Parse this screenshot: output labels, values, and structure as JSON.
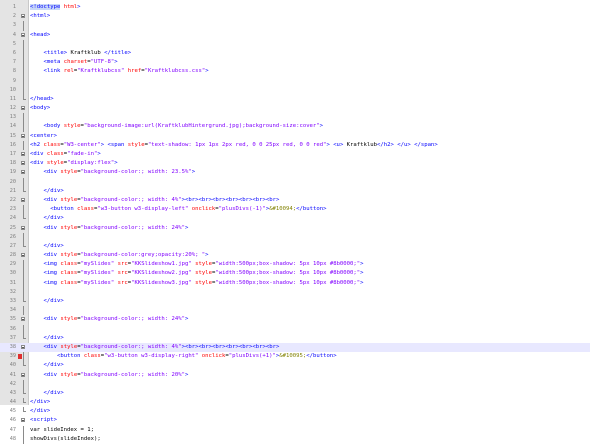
{
  "editor": {
    "lines": [
      {
        "n": "1",
        "fold": "",
        "text": "<!doctype html>"
      },
      {
        "n": "2",
        "fold": "open",
        "text": "<html>"
      },
      {
        "n": "3",
        "fold": "bar",
        "text": ""
      },
      {
        "n": "4",
        "fold": "open",
        "text": "<head>"
      },
      {
        "n": "5",
        "fold": "bar",
        "text": ""
      },
      {
        "n": "6",
        "fold": "bar",
        "text": "    <title> Kraftklub </title>"
      },
      {
        "n": "7",
        "fold": "bar",
        "text": "    <meta charset=\"UTF-8\">"
      },
      {
        "n": "8",
        "fold": "bar",
        "text": "    <link rel=\"Kraftklubcss\" href=\"Kraftklubcss.css\">"
      },
      {
        "n": "9",
        "fold": "bar",
        "text": ""
      },
      {
        "n": "10",
        "fold": "bar",
        "text": ""
      },
      {
        "n": "11",
        "fold": "end",
        "text": "</head>"
      },
      {
        "n": "12",
        "fold": "open",
        "text": "<body>"
      },
      {
        "n": "13",
        "fold": "bar",
        "text": ""
      },
      {
        "n": "14",
        "fold": "bar",
        "text": "    <body style=\"background-image:url(KraftklubHintergrund.jpg);background-size:cover\">"
      },
      {
        "n": "15",
        "fold": "open",
        "text": "<center>"
      },
      {
        "n": "16",
        "fold": "bar",
        "text": "<h2 class=\"W3-center\"> <span style=\"text-shadow: 1px 1px 2px red, 0 0 25px red, 0 0 red\"> <u> Kraftklub</h2> </u> </span>"
      },
      {
        "n": "17",
        "fold": "open",
        "text": "<div class=\"fade-in\">"
      },
      {
        "n": "18",
        "fold": "open",
        "text": "<div style=\"display:flex\">"
      },
      {
        "n": "19",
        "fold": "open",
        "text": "    <div style=\"background-color:; width: 23.5%\">"
      },
      {
        "n": "20",
        "fold": "bar",
        "text": ""
      },
      {
        "n": "21",
        "fold": "end",
        "text": "    </div>"
      },
      {
        "n": "22",
        "fold": "open",
        "text": "    <div style=\"background-color:; width: 4%\"><br><br><br><br><br><br><br>"
      },
      {
        "n": "23",
        "fold": "bar",
        "text": "      <button class=\"w3-button w3-display-left\" onclick=\"plusDivs(-1)\">&#10094;</button>"
      },
      {
        "n": "24",
        "fold": "end",
        "text": "    </div>"
      },
      {
        "n": "25",
        "fold": "open",
        "text": "    <div style=\"background-color:; width: 24%\">"
      },
      {
        "n": "26",
        "fold": "bar",
        "text": ""
      },
      {
        "n": "27",
        "fold": "end",
        "text": "    </div>"
      },
      {
        "n": "28",
        "fold": "open",
        "text": "    <div style=\"background-color:grey;opacity:20%; \">"
      },
      {
        "n": "29",
        "fold": "bar",
        "text": "    <img class=\"mySlides\" src=\"KKSlideshow1.jpg\" style=\"width:500px;box-shadow: 5px 10px #8b0000;\">"
      },
      {
        "n": "30",
        "fold": "bar",
        "text": "    <img class=\"mySlides\" src=\"KKSlideshow2.jpg\" style=\"width:500px;box-shadow: 5px 10px #8b0000;\">"
      },
      {
        "n": "31",
        "fold": "bar",
        "text": "    <img class=\"mySlides\" src=\"KKSlideshow3.jpg\" style=\"width:500px;box-shadow: 5px 10px #8b0000;\">"
      },
      {
        "n": "32",
        "fold": "bar",
        "text": ""
      },
      {
        "n": "33",
        "fold": "end",
        "text": "    </div>"
      },
      {
        "n": "34",
        "fold": "bar",
        "text": ""
      },
      {
        "n": "35",
        "fold": "open",
        "text": "    <div style=\"background-color:; width: 24%\">"
      },
      {
        "n": "36",
        "fold": "bar",
        "text": ""
      },
      {
        "n": "37",
        "fold": "end",
        "text": "    </div>"
      },
      {
        "n": "38",
        "fold": "open",
        "text": "    <div style=\"background-color:; width: 4%\"><br><br><br><br><br><br><br>"
      },
      {
        "n": "39",
        "fold": "marker",
        "text": "        <button class=\"w3-button w3-display-right\" onclick=\"plusDivs(+1)\">&#10095;</button>"
      },
      {
        "n": "40",
        "fold": "end",
        "text": "    </div>"
      },
      {
        "n": "41",
        "fold": "open",
        "text": "    <div style=\"background-color:; width: 20%\">"
      },
      {
        "n": "42",
        "fold": "bar",
        "text": ""
      },
      {
        "n": "43",
        "fold": "end",
        "text": "    </div>"
      },
      {
        "n": "44",
        "fold": "end",
        "text": "</div>"
      },
      {
        "n": "45",
        "fold": "end",
        "text": "</div>"
      },
      {
        "n": "46",
        "fold": "open",
        "text": "<script>"
      },
      {
        "n": "47",
        "fold": "bar",
        "text": "var slideIndex = 1;"
      },
      {
        "n": "48",
        "fold": "bar",
        "text": "showDivs(slideIndex);"
      }
    ],
    "highlighted_line": "38",
    "colors": {
      "tag": "#0000ff",
      "attr": "#ff0000",
      "string": "#8000ff",
      "entity": "#808000",
      "plain": "#000000",
      "gutter_bg": "#e4e4e4",
      "highlight": "#e8e8ff",
      "bookmark": "#e03030"
    }
  }
}
